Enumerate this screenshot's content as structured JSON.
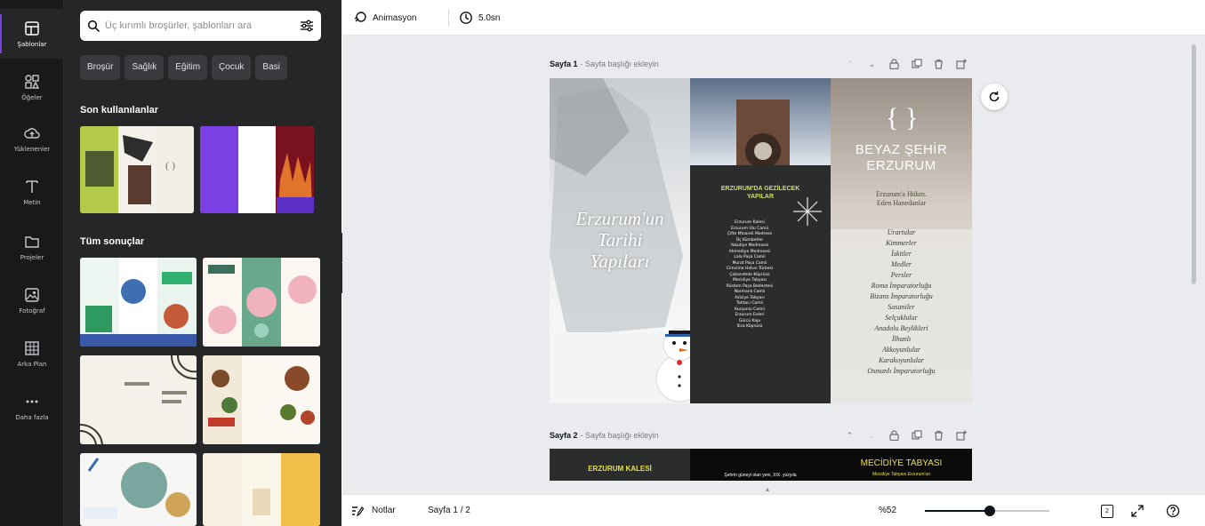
{
  "rail": {
    "items": [
      {
        "label": "Şablonlar",
        "icon": "templates-icon",
        "active": true
      },
      {
        "label": "Öğeler",
        "icon": "elements-icon"
      },
      {
        "label": "Yüklenenler",
        "icon": "upload-cloud-icon"
      },
      {
        "label": "Metin",
        "icon": "text-icon"
      },
      {
        "label": "Projeler",
        "icon": "folder-icon"
      },
      {
        "label": "Fotoğraf",
        "icon": "photo-icon"
      },
      {
        "label": "Arka Plan",
        "icon": "background-icon"
      },
      {
        "label": "Daha fazla",
        "icon": "more-icon"
      }
    ]
  },
  "panel": {
    "search_placeholder": "Üç kırımlı broşürler, şablonları ara",
    "chips": [
      "Broşür",
      "Sağlık",
      "Eğitim",
      "Çocuk",
      "Basi"
    ],
    "recent_title": "Son kullanılanlar",
    "results_title": "Tüm sonuçlar"
  },
  "topbar": {
    "animation_label": "Animasyon",
    "duration_label": "5.0sn"
  },
  "pages": [
    {
      "number": "Sayfa 1",
      "title": "- Sayfa başlığı ekleyin"
    },
    {
      "number": "Sayfa 2",
      "title": "- Sayfa başlığı ekleyin"
    }
  ],
  "brochure1": {
    "left_title": [
      "Erzurum'un",
      "Tarihi",
      "Yapıları"
    ],
    "mid_heading": [
      "ERZURUM'DA GEZİLECEK",
      "YAPILAR"
    ],
    "mid_list": [
      "Erzurum Kalesi",
      "Erzurum Ulu Camii",
      "Çifte Minareli Medrese",
      "Üç Kümbetler",
      "Yakutiye Medresesi",
      "Ahmediye Medresesi",
      "Lala Paşa Camii",
      "Murat Paşa Camii",
      "Cimcime Hatun Türbesi",
      "Çobandede Köprüsü",
      "Mecidiye Tabyası",
      "Rüstem Paşa Bedesteni",
      "Narmanlı Camii",
      "Aziziye Tabyası",
      "Tahtacı Camii",
      "Kurşunlu Camii",
      "Erzurum Evleri",
      "Gürcü Kapı",
      "İlica Köprüsü"
    ],
    "right_title": [
      "BEYAZ ŞEHİR",
      "ERZURUM"
    ],
    "right_subtitle": [
      "Erzurum'a Hükm.",
      "Eden Hanedanlar"
    ],
    "right_list": [
      "Urartular",
      "Kimmerler",
      "İskitler",
      "Medler",
      "Persler",
      "Roma İmparatorluğu",
      "Bizans İmparatorluğu",
      "Sasaniler",
      "Selçuklular",
      "Anadolu Beylikleri",
      "İlhanlı",
      "Akkoyunlular",
      "Karakoyunlular",
      "Osmanlı İmparatorluğu"
    ]
  },
  "brochure2": {
    "left_title": "ERZURUM KALESİ",
    "mid_text": "Şehrin güneyi olan yeni, XIX. yüzyıla",
    "right_title": "MECİDİYE TABYASI",
    "right_text": "Mecidiye Tabyası Erzurum'un"
  },
  "bottombar": {
    "notes_label": "Notlar",
    "page_indicator": "Sayfa 1 / 2",
    "zoom_label": "%52",
    "zoom_fraction": 0.52,
    "page_count": "2"
  },
  "colors": {
    "accent": "#7b3fe4",
    "dark_panel": "#2a2d2c",
    "lime_text": "#c8e06a",
    "yellow_text": "#e8e04a"
  }
}
